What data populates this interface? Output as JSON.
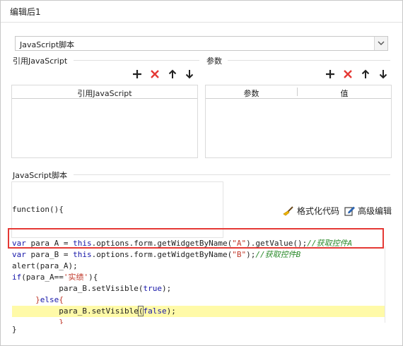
{
  "window": {
    "title": "编辑后1"
  },
  "script_type": {
    "selected": "JavaScript脚本"
  },
  "ref_js": {
    "label": "引用JavaScript",
    "column": "引用JavaScript"
  },
  "params": {
    "label": "参数",
    "columns": [
      "参数",
      "值"
    ]
  },
  "toolbar_icons": [
    "plus-icon",
    "delete-icon",
    "arrow-up-icon",
    "arrow-down-icon"
  ],
  "script": {
    "label": "JavaScript脚本",
    "header": "function(){",
    "format_label": "格式化代码",
    "advanced_label": "高级编辑",
    "footer": "}",
    "lines": {
      "l1_kw": "var",
      "l1_a": " para_A = ",
      "l1_this": "this",
      "l1_b": ".options.form.getWidgetByName(",
      "l1_str": "\"A\"",
      "l1_c": ").getValue();",
      "l1_cm": "//获取控件A",
      "l2_kw": "var",
      "l2_a": " para_B = ",
      "l2_this": "this",
      "l2_b": ".options.form.getWidgetByName(",
      "l2_str": "\"B\"",
      "l2_c": ");",
      "l2_cm": "//获取控件B",
      "l3": "alert(para_A);",
      "l4_kw": "if",
      "l4_a": "(para_A==",
      "l4_str": "'实绩'",
      "l4_b": "){",
      "l5_a": "para_B.setVisible(",
      "l5_kw": "true",
      "l5_b": ");",
      "l6_a": "}",
      "l6_kw": "else",
      "l6_b": "{",
      "l7_a": "para_B.setVisible",
      "l7_paren": "(",
      "l7_kw": "false",
      "l7_b": ");",
      "l8": "}"
    }
  },
  "colors": {
    "accent_red": "#e53935",
    "keyword": "#1515a8",
    "string": "#c0392b",
    "comment": "#2a8a2a",
    "current_line": "#fffaa8"
  }
}
